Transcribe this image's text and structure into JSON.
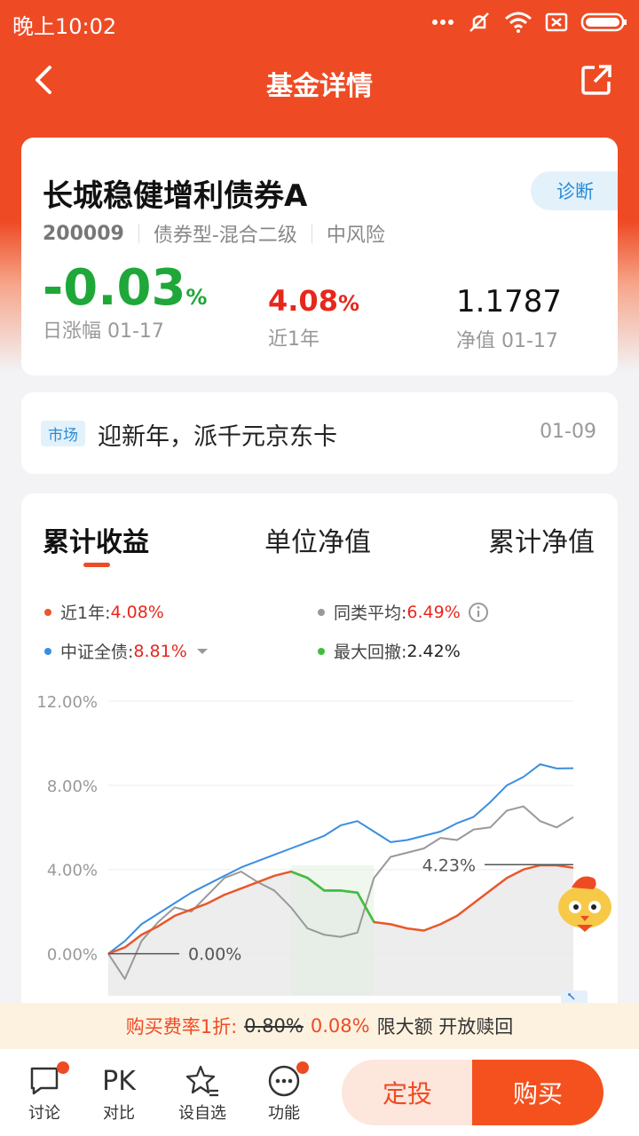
{
  "status_bar": {
    "time": "晚上10:02"
  },
  "header": {
    "title": "基金详情"
  },
  "fund": {
    "name": "长城稳健增利债券A",
    "diagnose_label": "诊断",
    "code": "200009",
    "type": "债券型-混合二级",
    "risk": "中风险",
    "daily_change": "-0.03",
    "daily_change_unit": "%",
    "daily_label": "日涨幅 01-17",
    "year_return": "4.08",
    "year_return_unit": "%",
    "year_label": "近1年",
    "nav": "1.1787",
    "nav_label": "净值 01-17"
  },
  "news": {
    "tag": "市场",
    "text": "迎新年，派千元京东卡",
    "date": "01-09"
  },
  "chart_tabs": [
    "累计收益",
    "单位净值",
    "累计净值"
  ],
  "legend": {
    "fund_label": "近1年:",
    "fund_value": "4.08%",
    "avg_label": "同类平均:",
    "avg_value": "6.49%",
    "bench_label": "中证全债:",
    "bench_value": "8.81%",
    "drawdown_label": "最大回撤:",
    "drawdown_value": "2.42%"
  },
  "colors": {
    "brand": "#ee4b25",
    "fund_line": "#e8582a",
    "avg_line": "#999999",
    "bench_line": "#3a8ee0",
    "drawdown_line": "#3fbf3f",
    "up": "#e8271c",
    "down": "#1fa73a"
  },
  "chart_data": {
    "type": "line",
    "ylabel": "",
    "yticks": [
      "12.00%",
      "8.00%",
      "4.00%",
      "0.00%"
    ],
    "ylim": [
      -2,
      12
    ],
    "annotations": [
      "0.00%",
      "4.23%"
    ],
    "series": [
      {
        "name": "近1年",
        "values": [
          0,
          0.3,
          0.9,
          1.3,
          1.8,
          2.1,
          2.4,
          2.8,
          3.1,
          3.4,
          3.7,
          3.9,
          3.6,
          3.0,
          3.0,
          2.9,
          1.5,
          1.4,
          1.2,
          1.1,
          1.4,
          1.8,
          2.4,
          3.0,
          3.6,
          4.0,
          4.2,
          4.2,
          4.08
        ]
      },
      {
        "name": "同类平均",
        "values": [
          0,
          -1.2,
          0.6,
          1.5,
          2.2,
          2.0,
          2.8,
          3.6,
          3.9,
          3.4,
          3.0,
          2.2,
          1.2,
          0.9,
          0.8,
          1.0,
          3.6,
          4.6,
          4.8,
          5.0,
          5.5,
          5.4,
          5.9,
          6.0,
          6.8,
          7.0,
          6.3,
          6.0,
          6.49
        ]
      },
      {
        "name": "中证全债",
        "values": [
          0,
          0.6,
          1.4,
          1.9,
          2.4,
          2.9,
          3.3,
          3.7,
          4.1,
          4.4,
          4.7,
          5.0,
          5.3,
          5.6,
          6.1,
          6.3,
          5.8,
          5.3,
          5.4,
          5.6,
          5.8,
          6.2,
          6.5,
          7.2,
          8.0,
          8.4,
          9.0,
          8.8,
          8.81
        ]
      }
    ]
  },
  "buy_banner": {
    "text1": "购买费率1折:",
    "old_rate": "0.80%",
    "new_rate": "0.08%",
    "text2": "限大额 开放赎回"
  },
  "bottom_bar": {
    "discuss": "讨论",
    "pk_icon": "PK",
    "compare": "对比",
    "watch": "设自选",
    "func": "功能",
    "dingtou": "定投",
    "buy": "购买"
  }
}
